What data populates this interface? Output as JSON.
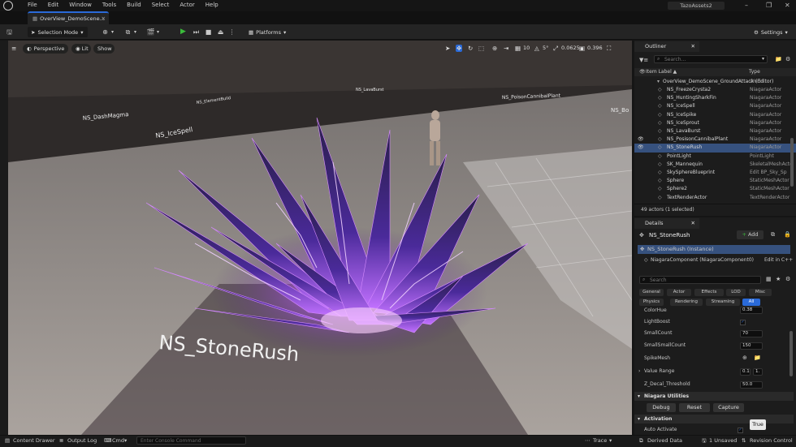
{
  "app": {
    "menu": [
      "File",
      "Edit",
      "Window",
      "Tools",
      "Build",
      "Select",
      "Actor",
      "Help"
    ],
    "project_name": "TazoAssets2",
    "level_tab": "OverView_DemoScene..."
  },
  "toolbar": {
    "selection_mode": "Selection Mode",
    "platforms": "Platforms",
    "settings": "Settings"
  },
  "viewport": {
    "perspective": "Perspective",
    "lit": "Lit",
    "show": "Show",
    "grid_snap": "10",
    "rot_snap": "5°",
    "scale_snap": "0.0625",
    "camera_speed": "0.396",
    "labels": {
      "dashmagma": "NS_DashMagma",
      "icespell": "NS_IceSpell",
      "stonerush": "NS_StoneRush",
      "lavaburst": "NS_LavaBurst",
      "poisoncannibal": "NS_PoisonCannibalPlant",
      "generic": "NS_ElementBuild",
      "edge": "NS_Bo"
    }
  },
  "outliner": {
    "tab": "Outliner",
    "search_placeholder": "Search...",
    "col_label": "Item Label ▲",
    "col_type": "Type",
    "root": "OverView_DemoScene_GroundAttack (Editor)",
    "root_type": "World",
    "rows": [
      {
        "name": "NS_FreezeCrysta2",
        "type": "NiagaraActor"
      },
      {
        "name": "NS_HuntingSharkFin",
        "type": "NiagaraActor"
      },
      {
        "name": "NS_IceSpell",
        "type": "NiagaraActor"
      },
      {
        "name": "NS_IceSpike",
        "type": "NiagaraActor"
      },
      {
        "name": "NS_IceSprout",
        "type": "NiagaraActor"
      },
      {
        "name": "NS_LavaBurst",
        "type": "NiagaraActor"
      },
      {
        "name": "NS_PosisonCannibalPlant",
        "type": "NiagaraActor"
      },
      {
        "name": "NS_StoneRush",
        "type": "NiagaraActor"
      },
      {
        "name": "PointLight",
        "type": "PointLight"
      },
      {
        "name": "SK_Mannequin",
        "type": "SkeletalMeshActor"
      },
      {
        "name": "SkySphereBlueprint",
        "type": "Edit BP_Sky_Sp"
      },
      {
        "name": "Sphere",
        "type": "StaticMeshActor"
      },
      {
        "name": "Sphere2",
        "type": "StaticMeshActor"
      },
      {
        "name": "TextRenderActor",
        "type": "TextRenderActor"
      }
    ],
    "footer": "49 actors (1 selected)"
  },
  "details": {
    "tab": "Details",
    "actor_name": "NS_StoneRush",
    "add_label": "Add",
    "instance": "NS_StoneRush (Instance)",
    "component": "NiagaraComponent (NiagaraComponent0)",
    "edit_cpp": "Edit in C++",
    "search_placeholder": "Search",
    "filters_row1": [
      "General",
      "Actor",
      "Effects",
      "LOD",
      "Misc"
    ],
    "filters_row2": [
      "Physics",
      "Rendering",
      "Streaming",
      "All"
    ],
    "props": [
      {
        "label": "ColorHue",
        "value": "0.38"
      },
      {
        "label": "LightBoost",
        "value": ""
      },
      {
        "label": "SmallCount",
        "value": "70"
      },
      {
        "label": "SmallSmallCount",
        "value": "150"
      },
      {
        "label": "SpikeMesh",
        "value": ""
      },
      {
        "label": "Value Range",
        "value": "0.1"
      },
      {
        "label": "Z_Decal_Threshold",
        "value": "50.0"
      }
    ],
    "value_range_second": "1.",
    "section_utilities": "Niagara Utilities",
    "btn_debug": "Debug",
    "btn_reset": "Reset",
    "btn_capture": "Capture",
    "section_activation": "Activation",
    "auto_activate": "Auto Activate",
    "tooltip": "True"
  },
  "statusbar": {
    "content_drawer": "Content Drawer",
    "output_log": "Output Log",
    "cmd": "Cmd",
    "console_placeholder": "Enter Console Command",
    "trace": "Trace",
    "derived_data": "Derived Data",
    "unsaved": "1 Unsaved",
    "revision": "Revision Control"
  },
  "colors": {
    "accent": "#2a6ad8",
    "selected_row": "#36517e",
    "play_green": "#3bbb3b",
    "crystal_glow": "#b54bff"
  }
}
